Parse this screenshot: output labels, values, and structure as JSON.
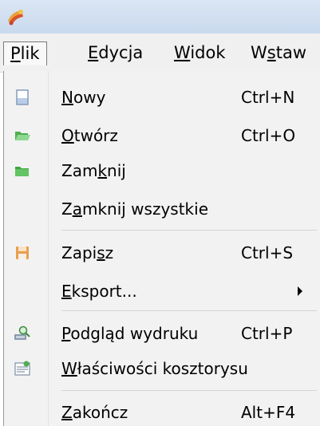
{
  "menubar": {
    "items": [
      {
        "label": "Plik",
        "active": true
      },
      {
        "label": "Edycja",
        "active": false
      },
      {
        "label": "Widok",
        "active": false
      },
      {
        "label": "Wstaw",
        "active": false
      }
    ]
  },
  "menu": {
    "items": [
      {
        "label": "Nowy",
        "mnemonic": "N",
        "shortcut": "Ctrl+N",
        "icon": "new-document-icon"
      },
      {
        "label": "Otwórz",
        "mnemonic": "O",
        "shortcut": "Ctrl+O",
        "icon": "open-folder-icon"
      },
      {
        "label": "Zamknij",
        "mnemonic": "k",
        "shortcut": "",
        "icon": "close-folder-icon"
      },
      {
        "label": "Zamknij wszystkie",
        "mnemonic": "a",
        "shortcut": "",
        "icon": ""
      },
      {
        "label": "Zapisz",
        "mnemonic": "s",
        "shortcut": "Ctrl+S",
        "icon": "save-icon"
      },
      {
        "label": "Eksport...",
        "mnemonic": "E",
        "shortcut": "",
        "icon": "",
        "submenu": true
      },
      {
        "label": "Podgląd wydruku",
        "mnemonic": "P",
        "shortcut": "Ctrl+P",
        "icon": "print-preview-icon"
      },
      {
        "label": "Właściwości kosztorysu",
        "mnemonic": "W",
        "shortcut": "",
        "icon": "properties-icon"
      },
      {
        "label": "Zakończ",
        "mnemonic": "Z",
        "shortcut": "Alt+F4",
        "icon": ""
      }
    ]
  },
  "colors": {
    "titlebar": "#c9d9ee",
    "menubar": "#f0f0f0",
    "dropdown": "#f2f2f2",
    "folder_green": "#5fbf5f",
    "save_orange": "#e8a050"
  }
}
